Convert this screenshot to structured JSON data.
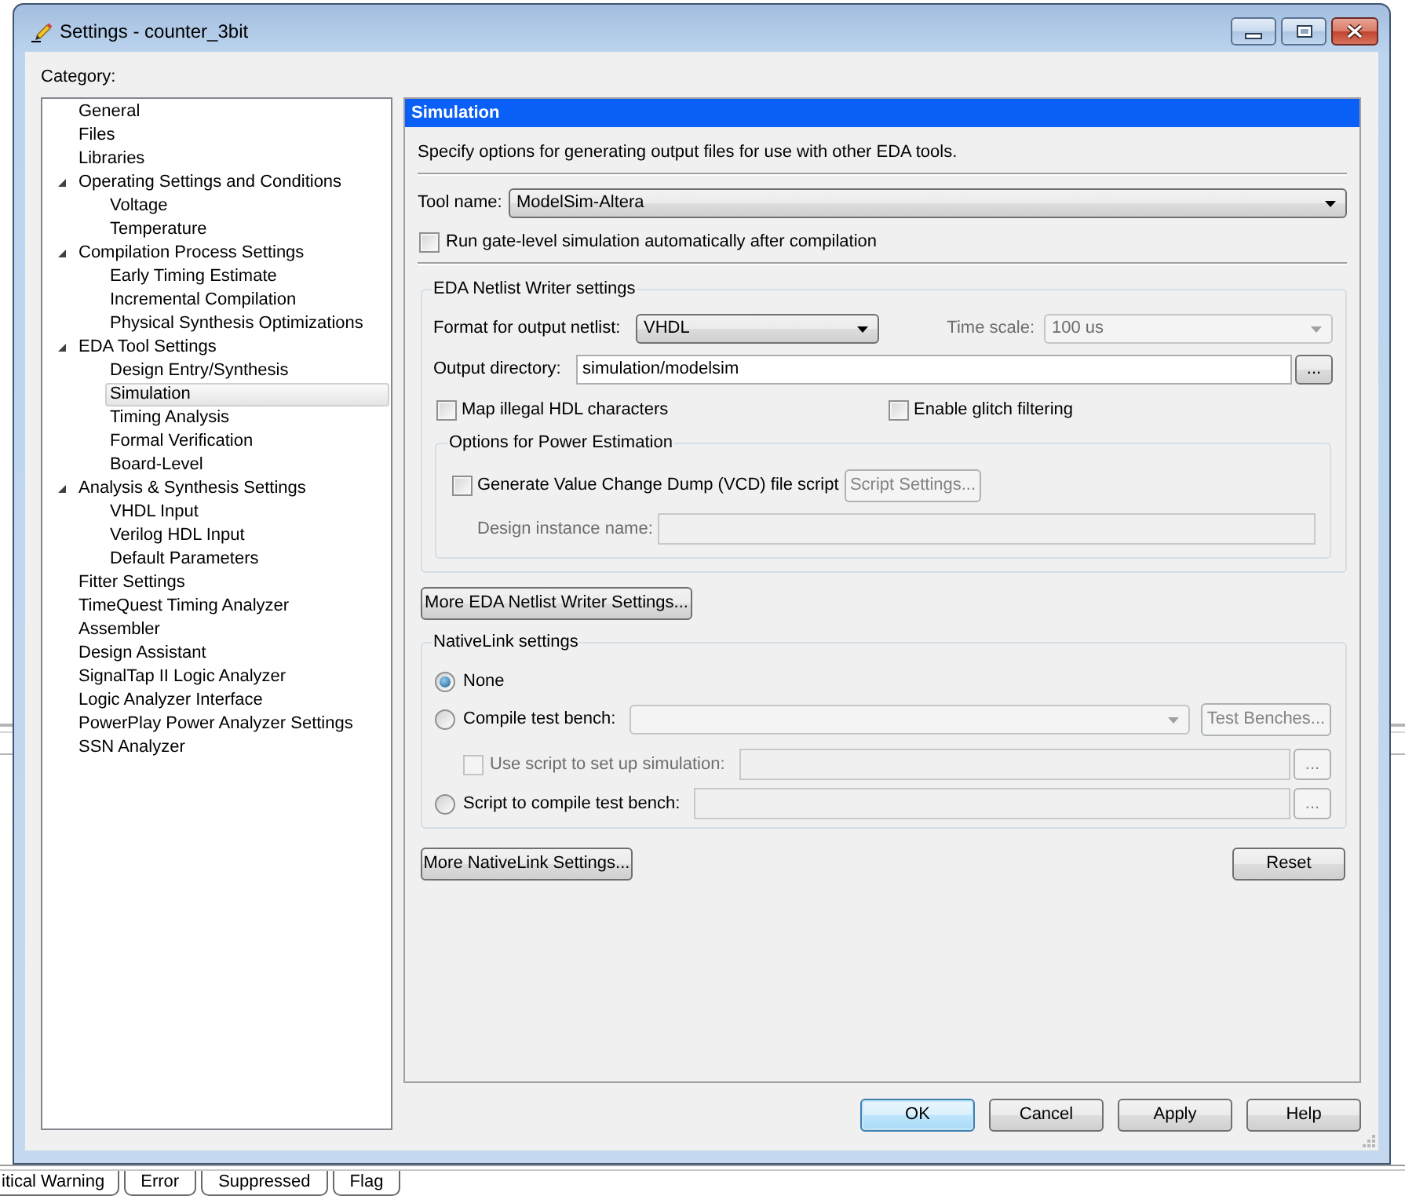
{
  "window": {
    "title": "Settings - counter_3bit"
  },
  "category": {
    "label": "Category:",
    "tree": [
      {
        "label": "General",
        "selected": false
      },
      {
        "label": "Files",
        "selected": false
      },
      {
        "label": "Libraries",
        "selected": false
      },
      {
        "label": "Operating Settings and Conditions",
        "selected": false,
        "expanded": true,
        "children": [
          {
            "label": "Voltage",
            "selected": false
          },
          {
            "label": "Temperature",
            "selected": false
          }
        ]
      },
      {
        "label": "Compilation Process Settings",
        "selected": false,
        "expanded": true,
        "children": [
          {
            "label": "Early Timing Estimate",
            "selected": false
          },
          {
            "label": "Incremental Compilation",
            "selected": false
          },
          {
            "label": "Physical Synthesis Optimizations",
            "selected": false
          }
        ]
      },
      {
        "label": "EDA Tool Settings",
        "selected": false,
        "expanded": true,
        "children": [
          {
            "label": "Design Entry/Synthesis",
            "selected": false
          },
          {
            "label": "Simulation",
            "selected": true
          },
          {
            "label": "Timing Analysis",
            "selected": false
          },
          {
            "label": "Formal Verification",
            "selected": false
          },
          {
            "label": "Board-Level",
            "selected": false
          }
        ]
      },
      {
        "label": "Analysis & Synthesis Settings",
        "selected": false,
        "expanded": true,
        "children": [
          {
            "label": "VHDL Input",
            "selected": false
          },
          {
            "label": "Verilog HDL Input",
            "selected": false
          },
          {
            "label": "Default Parameters",
            "selected": false
          }
        ]
      },
      {
        "label": "Fitter Settings",
        "selected": false
      },
      {
        "label": "TimeQuest Timing Analyzer",
        "selected": false
      },
      {
        "label": "Assembler",
        "selected": false
      },
      {
        "label": "Design Assistant",
        "selected": false
      },
      {
        "label": "SignalTap II Logic Analyzer",
        "selected": false
      },
      {
        "label": "Logic Analyzer Interface",
        "selected": false
      },
      {
        "label": "PowerPlay Power Analyzer Settings",
        "selected": false
      },
      {
        "label": "SSN Analyzer",
        "selected": false
      }
    ]
  },
  "page": {
    "title": "Simulation",
    "description": "Specify options for generating output files for use with other EDA tools.",
    "tool_name": {
      "label": "Tool name:",
      "value": "ModelSim-Altera"
    },
    "run_gate_level": {
      "label": "Run gate-level simulation automatically after compilation",
      "checked": false
    },
    "netlist_writer": {
      "title": "EDA Netlist Writer settings",
      "format": {
        "label": "Format for output netlist:",
        "value": "VHDL",
        "disabled": false
      },
      "time_scale": {
        "label": "Time scale:",
        "value": "100 us",
        "disabled": true
      },
      "output_directory": {
        "label": "Output directory:",
        "value": "simulation/modelsim",
        "browse": {
          "label": "...",
          "disabled": false
        }
      },
      "options": [
        {
          "label": "Map illegal HDL characters",
          "checked": false
        },
        {
          "label": "Enable glitch filtering",
          "checked": false
        }
      ],
      "power_estimation": {
        "title": "Options for Power Estimation",
        "vcd_script": {
          "label": "Generate Value Change Dump (VCD) file script",
          "checked": false
        },
        "script_settings": {
          "label": "Script Settings...",
          "disabled": true
        },
        "design_instance_name": {
          "label": "Design instance name:",
          "disabled": true
        }
      }
    },
    "more_netlist_button": {
      "label": "More EDA Netlist Writer Settings..."
    },
    "nativelink": {
      "title": "NativeLink settings",
      "rows": [
        {
          "kind": "radio",
          "label": "None",
          "selected": true
        },
        {
          "kind": "radio_dropdown",
          "label": "Compile test bench:",
          "selected": false,
          "field_disabled": true,
          "button": {
            "label": "Test Benches...",
            "disabled": true
          }
        },
        {
          "kind": "checkbox_path",
          "label": "Use script to set up simulation:",
          "checked": false,
          "disabled": true,
          "field_disabled": true,
          "browse": {
            "label": "...",
            "disabled": true
          }
        },
        {
          "kind": "radio_path",
          "label": "Script to compile test bench:",
          "selected": false,
          "field_disabled": true,
          "browse": {
            "label": "...",
            "disabled": true
          }
        }
      ]
    },
    "more_nativelink_button": {
      "label": "More NativeLink Settings..."
    },
    "reset_button": {
      "label": "Reset"
    }
  },
  "dialog_buttons": [
    {
      "label": "OK",
      "default": true
    },
    {
      "label": "Cancel",
      "default": false
    },
    {
      "label": "Apply",
      "default": false
    },
    {
      "label": "Help",
      "default": false
    }
  ],
  "message_tabs": [
    {
      "label": "itical Warning"
    },
    {
      "label": "Error"
    },
    {
      "label": "Suppressed"
    },
    {
      "label": "Flag"
    }
  ]
}
